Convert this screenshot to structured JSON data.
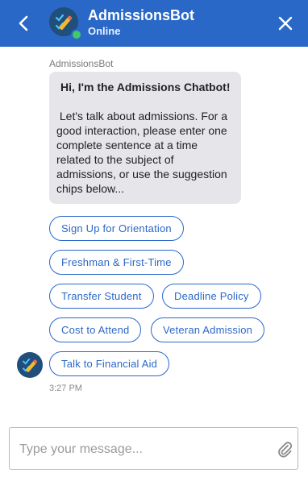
{
  "header": {
    "back_icon": "chevron-left-icon",
    "bot_name": "AdmissionsBot",
    "status": "Online",
    "close_icon": "close-icon",
    "background": "#2a68c8",
    "status_color": "#3ecb6a"
  },
  "message": {
    "sender": "AdmissionsBot",
    "title": "Hi, I'm the Admissions Chatbot!",
    "body": " Let's talk about admissions. For a good interaction, please enter one complete sentence at a time related to the subject of admissions, or use the suggestion chips below...",
    "time": "3:27 PM"
  },
  "chips": [
    "Sign Up for Orientation",
    "Freshman & First-Time",
    "Transfer Student",
    "Deadline Policy",
    "Cost to Attend",
    "Veteran Admission",
    "Talk to Financial Aid"
  ],
  "composer": {
    "placeholder": "Type your message...",
    "value": "",
    "attach_icon": "paperclip-icon"
  }
}
